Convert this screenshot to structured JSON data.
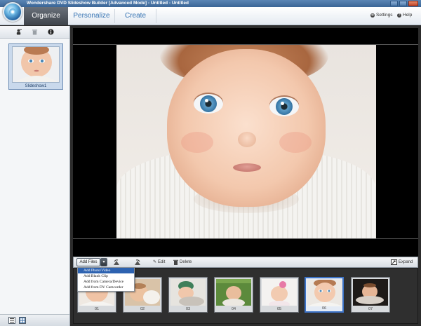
{
  "window": {
    "title": "Wondershare DVD Slideshow Builder [Advanced Mode] - Untitled - Untitled"
  },
  "header": {
    "tabs": [
      {
        "label": "Organize",
        "active": true
      },
      {
        "label": "Personalize",
        "active": false
      },
      {
        "label": "Create",
        "active": false
      }
    ],
    "settings_label": "Settings",
    "help_label": "Help"
  },
  "left_panel": {
    "slideshows": [
      {
        "label": "Slideshow1",
        "selected": true
      }
    ]
  },
  "toolbar": {
    "add_files_label": "Add Files",
    "edit_label": "Edit",
    "delete_label": "Delete",
    "expand_label": "Expand"
  },
  "add_menu": {
    "items": [
      {
        "label": "Add Photo/Video",
        "highlighted": true
      },
      {
        "label": "Add Blank Clip",
        "highlighted": false
      },
      {
        "label": "Add from Camera/Device",
        "highlighted": false
      },
      {
        "label": "Add from DV Camcorder",
        "highlighted": false
      }
    ]
  },
  "filmstrip": {
    "frames": [
      {
        "number": "01",
        "selected": false
      },
      {
        "number": "02",
        "selected": false
      },
      {
        "number": "03",
        "selected": false
      },
      {
        "number": "04",
        "selected": false
      },
      {
        "number": "05",
        "selected": false
      },
      {
        "number": "06",
        "selected": true
      },
      {
        "number": "07",
        "selected": false
      }
    ]
  },
  "colors": {
    "accent": "#3573b3",
    "selection": "#3d73c7",
    "menu_highlight": "#2d62b0"
  }
}
